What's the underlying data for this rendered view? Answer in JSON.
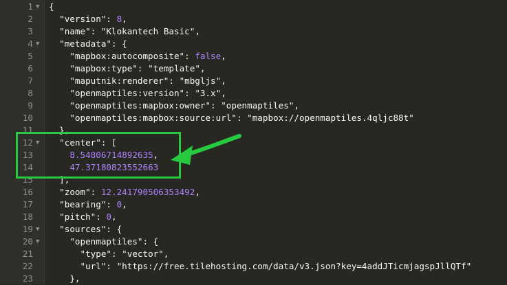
{
  "editor": {
    "lines": [
      {
        "n": "1",
        "fold": "▼",
        "parts": [
          {
            "t": "{",
            "c": "p"
          }
        ]
      },
      {
        "n": "2",
        "fold": "",
        "parts": [
          {
            "t": "  \"version\"",
            "c": "k"
          },
          {
            "t": ": ",
            "c": "p"
          },
          {
            "t": "8",
            "c": "n"
          },
          {
            "t": ",",
            "c": "p"
          }
        ]
      },
      {
        "n": "3",
        "fold": "",
        "parts": [
          {
            "t": "  \"name\"",
            "c": "k"
          },
          {
            "t": ": ",
            "c": "p"
          },
          {
            "t": "\"Klokantech Basic\"",
            "c": "s"
          },
          {
            "t": ",",
            "c": "p"
          }
        ]
      },
      {
        "n": "4",
        "fold": "▼",
        "parts": [
          {
            "t": "  \"metadata\"",
            "c": "k"
          },
          {
            "t": ": {",
            "c": "p"
          }
        ]
      },
      {
        "n": "5",
        "fold": "",
        "parts": [
          {
            "t": "    \"mapbox:autocomposite\"",
            "c": "k"
          },
          {
            "t": ": ",
            "c": "p"
          },
          {
            "t": "false",
            "c": "b"
          },
          {
            "t": ",",
            "c": "p"
          }
        ]
      },
      {
        "n": "6",
        "fold": "",
        "parts": [
          {
            "t": "    \"mapbox:type\"",
            "c": "k"
          },
          {
            "t": ": ",
            "c": "p"
          },
          {
            "t": "\"template\"",
            "c": "s"
          },
          {
            "t": ",",
            "c": "p"
          }
        ]
      },
      {
        "n": "7",
        "fold": "",
        "parts": [
          {
            "t": "    \"maputnik:renderer\"",
            "c": "k"
          },
          {
            "t": ": ",
            "c": "p"
          },
          {
            "t": "\"mbgljs\"",
            "c": "s"
          },
          {
            "t": ",",
            "c": "p"
          }
        ]
      },
      {
        "n": "8",
        "fold": "",
        "parts": [
          {
            "t": "    \"openmaptiles:version\"",
            "c": "k"
          },
          {
            "t": ": ",
            "c": "p"
          },
          {
            "t": "\"3.x\"",
            "c": "s"
          },
          {
            "t": ",",
            "c": "p"
          }
        ]
      },
      {
        "n": "9",
        "fold": "",
        "parts": [
          {
            "t": "    \"openmaptiles:mapbox:owner\"",
            "c": "k"
          },
          {
            "t": ": ",
            "c": "p"
          },
          {
            "t": "\"openmaptiles\"",
            "c": "s"
          },
          {
            "t": ",",
            "c": "p"
          }
        ]
      },
      {
        "n": "10",
        "fold": "",
        "parts": [
          {
            "t": "    \"openmaptiles:mapbox:source:url\"",
            "c": "k"
          },
          {
            "t": ": ",
            "c": "p"
          },
          {
            "t": "\"mapbox://openmaptiles.4qljc88t\"",
            "c": "s"
          }
        ]
      },
      {
        "n": "11",
        "fold": "",
        "parts": [
          {
            "t": "  },",
            "c": "p"
          }
        ]
      },
      {
        "n": "12",
        "fold": "▼",
        "parts": [
          {
            "t": "  \"center\"",
            "c": "k"
          },
          {
            "t": ": [",
            "c": "p"
          }
        ]
      },
      {
        "n": "13",
        "fold": "",
        "parts": [
          {
            "t": "    ",
            "c": "p"
          },
          {
            "t": "8.54806714892635",
            "c": "n"
          },
          {
            "t": ",",
            "c": "p"
          }
        ]
      },
      {
        "n": "14",
        "fold": "",
        "parts": [
          {
            "t": "    ",
            "c": "p"
          },
          {
            "t": "47.37180823552663",
            "c": "n"
          }
        ]
      },
      {
        "n": "15",
        "fold": "",
        "parts": [
          {
            "t": "  ],",
            "c": "p"
          }
        ]
      },
      {
        "n": "16",
        "fold": "",
        "parts": [
          {
            "t": "  \"zoom\"",
            "c": "k"
          },
          {
            "t": ": ",
            "c": "p"
          },
          {
            "t": "12.241790506353492",
            "c": "n"
          },
          {
            "t": ",",
            "c": "p"
          }
        ]
      },
      {
        "n": "17",
        "fold": "",
        "parts": [
          {
            "t": "  \"bearing\"",
            "c": "k"
          },
          {
            "t": ": ",
            "c": "p"
          },
          {
            "t": "0",
            "c": "n"
          },
          {
            "t": ",",
            "c": "p"
          }
        ]
      },
      {
        "n": "18",
        "fold": "",
        "parts": [
          {
            "t": "  \"pitch\"",
            "c": "k"
          },
          {
            "t": ": ",
            "c": "p"
          },
          {
            "t": "0",
            "c": "n"
          },
          {
            "t": ",",
            "c": "p"
          }
        ]
      },
      {
        "n": "19",
        "fold": "▼",
        "parts": [
          {
            "t": "  \"sources\"",
            "c": "k"
          },
          {
            "t": ": {",
            "c": "p"
          }
        ]
      },
      {
        "n": "20",
        "fold": "▼",
        "parts": [
          {
            "t": "    \"openmaptiles\"",
            "c": "k"
          },
          {
            "t": ": {",
            "c": "p"
          }
        ]
      },
      {
        "n": "21",
        "fold": "",
        "parts": [
          {
            "t": "      \"type\"",
            "c": "k"
          },
          {
            "t": ": ",
            "c": "p"
          },
          {
            "t": "\"vector\"",
            "c": "s"
          },
          {
            "t": ",",
            "c": "p"
          }
        ]
      },
      {
        "n": "22",
        "fold": "",
        "parts": [
          {
            "t": "      \"url\"",
            "c": "k"
          },
          {
            "t": ": ",
            "c": "p"
          },
          {
            "t": "\"https://free.tilehosting.com/data/v3.json?key=4addJTicmjagspJllQTf\"",
            "c": "s"
          }
        ]
      },
      {
        "n": "23",
        "fold": "",
        "parts": [
          {
            "t": "    },",
            "c": "p"
          }
        ]
      }
    ]
  },
  "colors": {
    "background": "#272822",
    "highlight": "#27c93f",
    "number": "#ae81ff"
  }
}
